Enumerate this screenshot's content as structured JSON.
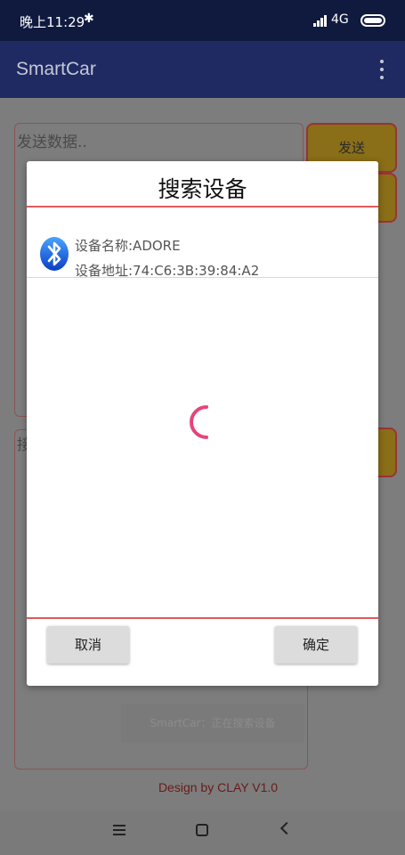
{
  "status_bar": {
    "time": "晚上11:29",
    "bluetooth_symbol": "✱",
    "network": "4G",
    "icons": [
      "bluetooth-icon",
      "signal-icon",
      "battery-icon"
    ]
  },
  "app_bar": {
    "title": "SmartCar",
    "menu_icon": "overflow-menu-icon"
  },
  "main": {
    "send_placeholder": "发送数据..",
    "send_button": "发送",
    "receive_label": "接",
    "toast": "SmartCar：正在搜索设备",
    "footer": "Design by CLAY V1.0"
  },
  "dialog": {
    "title": "搜索设备",
    "devices": [
      {
        "name_label": "设备名称:ADORE",
        "address_label": "设备地址:74:C6:3B:39:84:A2",
        "icon": "bluetooth-icon"
      }
    ],
    "loading": true,
    "cancel_button": "取消",
    "ok_button": "确定",
    "accent_color": "#e05a5a"
  },
  "nav_bar": {
    "icons": [
      "menu-icon",
      "home-icon",
      "back-icon"
    ]
  },
  "colors": {
    "status_bar": "#101a3f",
    "app_bar": "#1f2a63",
    "spinner": "#e6457a",
    "bluetooth_blue": "#1a5fe0"
  }
}
